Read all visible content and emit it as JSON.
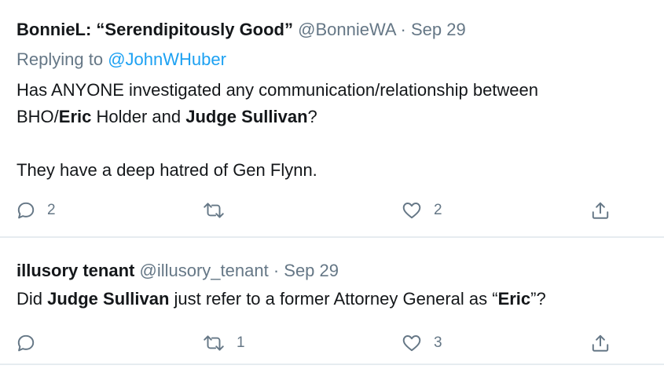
{
  "tweets": [
    {
      "display_name": "BonnieL: “Serendipitously Good”",
      "handle": "@BonnieWA",
      "separator": "·",
      "date": "Sep 29",
      "replying_to_label": "Replying to",
      "replying_to_handle": "@JohnWHuber",
      "body": {
        "l1": "Has ANYONE investigated any communication/relationship between",
        "l2a": "BHO/",
        "l2b": "Eric",
        "l2c": " Holder and ",
        "l2d": "Judge Sullivan",
        "l2e": "?",
        "l3": "They have a deep hatred of Gen Flynn."
      },
      "actions": {
        "reply_count": "2",
        "retweet_count": "",
        "like_count": "2",
        "reply_icon": "comment-icon",
        "retweet_icon": "retweet-icon",
        "like_icon": "heart-icon",
        "share_icon": "share-icon"
      }
    },
    {
      "display_name": "illusory tenant",
      "handle": "@illusory_tenant",
      "separator": "·",
      "date": "Sep 29",
      "body": {
        "p1": "Did ",
        "p2": "Judge Sullivan",
        "p3": " just refer to a former Attorney General as “",
        "p4": "Eric",
        "p5": "”?"
      },
      "actions": {
        "reply_count": "",
        "retweet_count": "1",
        "like_count": "3",
        "reply_icon": "comment-icon",
        "retweet_icon": "retweet-icon",
        "like_icon": "heart-icon",
        "share_icon": "share-icon"
      }
    }
  ],
  "colors": {
    "text": "#14171a",
    "secondary": "#657786",
    "link": "#1da1f2",
    "divider": "#e6ecf0"
  }
}
